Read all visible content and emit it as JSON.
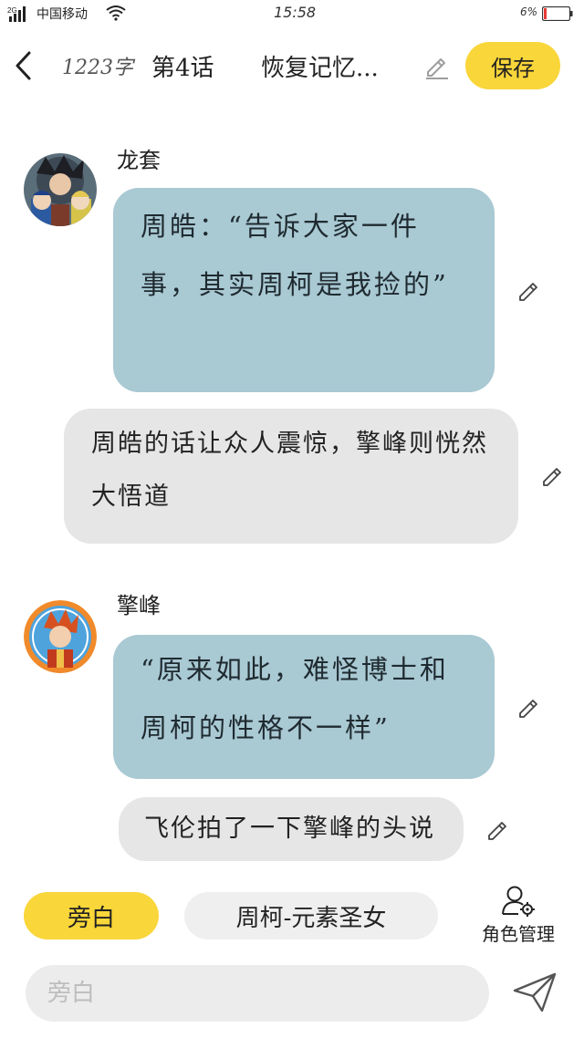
{
  "status_bar": {
    "network": "2G",
    "carrier": "中国移动",
    "time": "15:58",
    "battery": "6%",
    "icons": [
      "signal-icon",
      "wifi-icon",
      "battery-icon"
    ]
  },
  "header": {
    "word_count": "1223字",
    "chapter": "第4话",
    "title": "恢复记忆...",
    "save_label": "保存",
    "icons": [
      "back-arrow-icon",
      "edit-title-icon"
    ]
  },
  "messages": [
    {
      "speaker": "龙套",
      "text": "周皓：“告诉大家一件事，其实周柯是我捡的”"
    },
    {
      "narration": "周皓的话让众人震惊，擎峰则恍然大悟道"
    },
    {
      "speaker": "擎峰",
      "text": "“原来如此，难怪博士和周柯的性格不一样”"
    },
    {
      "narration": "飞伦拍了一下擎峰的头说"
    }
  ],
  "bottom": {
    "roles": [
      {
        "label": "旁白",
        "selected": true
      },
      {
        "label": "周柯-元素圣女",
        "selected": false
      }
    ],
    "role_manage_label": "角色管理",
    "input_placeholder": "旁白",
    "icons": [
      "role-manage-icon",
      "send-icon"
    ]
  },
  "colors": {
    "accent": "#f9d63a",
    "dialogue_bubble": "#a9c9d3",
    "narration_bubble": "#e6e6e6",
    "input_bg": "#ececec"
  }
}
